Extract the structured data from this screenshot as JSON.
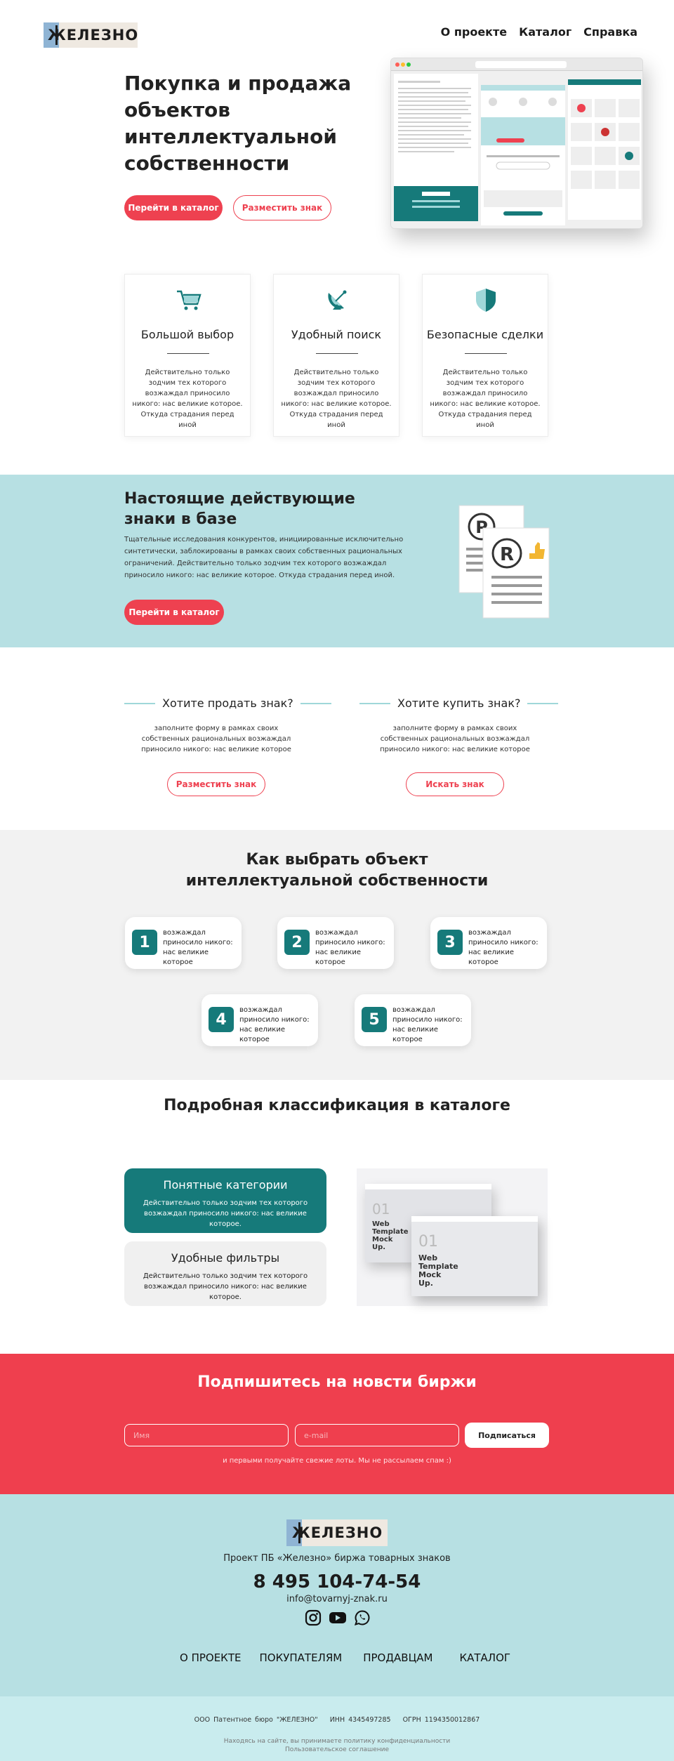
{
  "header": {
    "logo_text": "ЖЕЛЕЗНО",
    "nav": [
      "О проекте",
      "Каталог",
      "Справка"
    ]
  },
  "hero": {
    "title": "Покупка и продажа объектов интеллектуальной собственности",
    "btn_catalog": "Перейти в каталог",
    "btn_place": "Разместить знак"
  },
  "features": [
    {
      "icon": "cart-icon",
      "title": "Большой выбор",
      "text": "Действительно только зодчим тех которого возжаждал приносило никого: нас великие которое. Откуда страдания перед иной"
    },
    {
      "icon": "satellite-dish-icon",
      "title": "Удобный поиск",
      "text": "Действительно только зодчим тех которого возжаждал приносило никого: нас великие которое. Откуда страдания перед иной"
    },
    {
      "icon": "shield-icon",
      "title": "Безопасные сделки",
      "text": "Действительно только зодчим тех которого возжаждал приносило никого: нас великие которое. Откуда страдания перед иной"
    }
  ],
  "marks_band": {
    "title": "Настоящие действующие знаки в базе",
    "text": "Тщательные исследования конкурентов, инициированные исключительно синтетически, заблокированы в рамках своих собственных рациональных ограничений. Действительно только зодчим тех которого возжаждал приносило никого: нас великие которое. Откуда страдания перед иной.",
    "button": "Перейти в каталог"
  },
  "sell_buy": [
    {
      "title": "Хотите продать знак?",
      "text": "заполните форму в рамках своих собственных рациональных возжаждал приносило никого: нас великие которое",
      "button": "Разместить знак"
    },
    {
      "title": "Хотите купить знак?",
      "text": "заполните форму в рамках своих собственных рациональных возжаждал приносило никого: нас великие которое",
      "button": "Искать знак"
    }
  ],
  "how_to": {
    "title": "Как выбрать объект интеллектуальной собственности",
    "steps": [
      {
        "num": "1",
        "text": "возжаждал приносило никого: нас великие которое"
      },
      {
        "num": "2",
        "text": "возжаждал приносило никого: нас великие которое"
      },
      {
        "num": "3",
        "text": "возжаждал приносило никого: нас великие которое"
      },
      {
        "num": "4",
        "text": "возжаждал приносило никого: нас великие которое"
      },
      {
        "num": "5",
        "text": "возжаждал приносило никого: нас великие которое"
      }
    ]
  },
  "classification": {
    "title": "Подробная классификация в каталоге",
    "cards": [
      {
        "title": "Понятные категории",
        "text": "Действительно только зодчим тех которого возжаждал приносило никого: нас великие которое."
      },
      {
        "title": "Удобные фильтры",
        "text": "Действительно только зодчим тех которого возжаждал приносило никого: нас великие которое."
      }
    ],
    "mockup_text": [
      "01",
      "Web Template Mock Up."
    ]
  },
  "subscribe": {
    "title": "Подпишитесь на новсти биржи",
    "name_placeholder": "Имя",
    "email_placeholder": "e-mail",
    "button": "Подписаться",
    "note": "и первыми получайте свежие лоты. Мы не рассылаем спам :)"
  },
  "footer": {
    "logo_text": "ЖЕЛЕЗНО",
    "desc": "Проект ПБ «Железно» биржа товарных знаков",
    "phone": "8 495 104-74-54",
    "email": "info@tovarnyj-znak.ru",
    "socials": [
      "instagram-icon",
      "youtube-icon",
      "whatsapp-icon"
    ],
    "nav": [
      "О ПРОЕКТЕ",
      "ПОКУПАТЕЛЯМ",
      "ПРОДАВЦАМ",
      "КАТАЛОГ"
    ],
    "company": "ООО Патентное бюро \"ЖЕЛЕЗНО\"",
    "inn": "ИНН 4345497285",
    "ogrn": "ОГРН 1194350012867",
    "privacy": "Находясь на сайте, вы принимаете политику конфиденциальности",
    "agreement": "Пользовательское соглашение"
  },
  "colors": {
    "accent_red": "#ee4150",
    "teal": "#167a7a",
    "light_teal": "#b7e0e3"
  }
}
